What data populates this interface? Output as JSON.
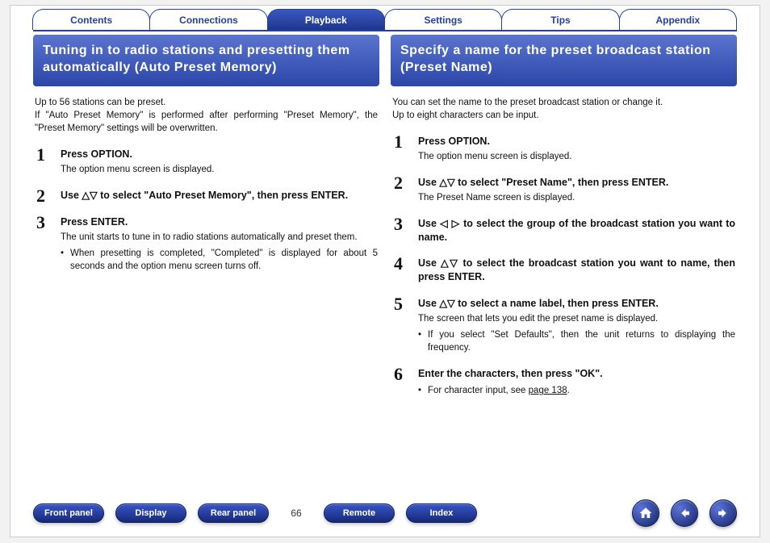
{
  "tabs": {
    "contents": "Contents",
    "connections": "Connections",
    "playback": "Playback",
    "settings": "Settings",
    "tips": "Tips",
    "appendix": "Appendix",
    "active": "playback"
  },
  "left": {
    "title": "Tuning in to radio stations and presetting them automatically (Auto Preset Memory)",
    "intro1": "Up to 56 stations can be preset.",
    "intro2": "If \"Auto Preset Memory\" is performed after performing \"Preset Memory\", the \"Preset Memory\" settings will be overwritten.",
    "steps": [
      {
        "title": "Press OPTION.",
        "sub": "The option menu screen is displayed."
      },
      {
        "title": "Use △▽ to select \"Auto Preset Memory\", then press ENTER."
      },
      {
        "title": "Press ENTER.",
        "sub": "The unit starts to tune in to radio stations automatically and preset them.",
        "bullet": "When presetting is completed, \"Completed\" is displayed for about 5 seconds and the option menu screen turns off."
      }
    ]
  },
  "right": {
    "title": "Specify a name for the preset broadcast station (Preset Name)",
    "intro1": "You can set the name to the preset broadcast station or change it.",
    "intro2": "Up to eight characters can be input.",
    "steps": [
      {
        "title": "Press OPTION.",
        "sub": "The option menu screen is displayed."
      },
      {
        "title": "Use △▽ to select \"Preset Name\", then press ENTER.",
        "sub": "The Preset Name screen is displayed."
      },
      {
        "title": "Use ◁ ▷ to select the group of the broadcast station you want to name."
      },
      {
        "title": "Use △▽ to select the broadcast station you want to name, then press ENTER."
      },
      {
        "title": "Use △▽ to select a name label, then press ENTER.",
        "sub": "The screen that lets you edit the preset name is displayed.",
        "bullet": "If you select \"Set Defaults\", then the unit returns to displaying the frequency."
      },
      {
        "title": "Enter the characters, then press \"OK\".",
        "bullet_prefix": "For character input, see ",
        "bullet_link": "page 138",
        "bullet_suffix": "."
      }
    ]
  },
  "footer": {
    "front_panel": "Front panel",
    "display": "Display",
    "rear_panel": "Rear panel",
    "page_number": "66",
    "remote": "Remote",
    "index": "Index"
  }
}
